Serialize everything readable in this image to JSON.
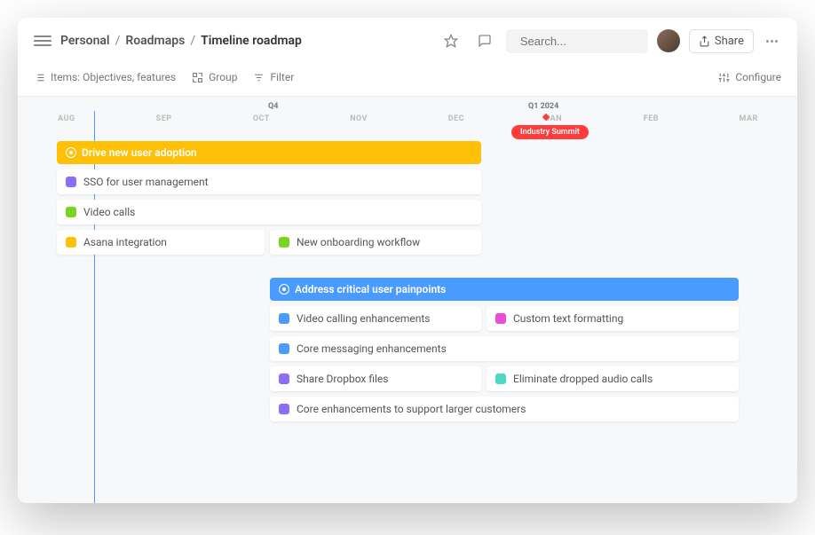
{
  "breadcrumb": {
    "a": "Personal",
    "b": "Roadmaps",
    "c": "Timeline roadmap"
  },
  "search": {
    "placeholder": "Search..."
  },
  "header": {
    "share": "Share"
  },
  "toolbar": {
    "items": "Items: Objectives, features",
    "group": "Group",
    "filter": "Filter",
    "configure": "Configure"
  },
  "quarters": {
    "q4": "Q4",
    "q1": "Q1 2024"
  },
  "months": [
    "AUG",
    "SEP",
    "OCT",
    "NOV",
    "DEC",
    "JAN",
    "FEB",
    "MAR"
  ],
  "event": {
    "label": "Industry Summit"
  },
  "objective1": {
    "title": "Drive new user adoption"
  },
  "objective2": {
    "title": "Address critical user painpoints"
  },
  "cards": {
    "sso": "SSO for user management",
    "video": "Video calls",
    "asana": "Asana integration",
    "onboard": "New onboarding workflow",
    "vce": "Video calling enhancements",
    "ctf": "Custom text formatting",
    "cme": "Core messaging enhancements",
    "sdf": "Share Dropbox files",
    "edac": "Eliminate dropped audio calls",
    "celarge": "Core enhancements to support larger customers"
  }
}
